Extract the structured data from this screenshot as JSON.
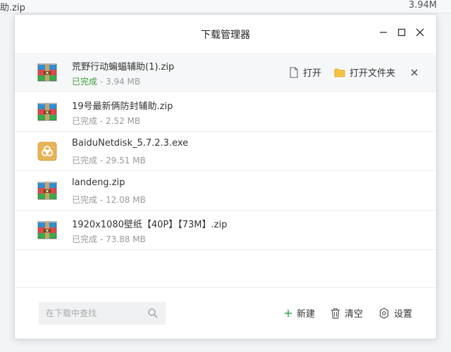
{
  "background": {
    "left_text": "助.zip",
    "right_text": "3.94M"
  },
  "dialog": {
    "title": "下载管理器"
  },
  "files": [
    {
      "name": "荒野行动蝙蝠辅助(1).zip",
      "status": "已完成",
      "size": "3.94 MB",
      "icon": "zip-archive-icon"
    },
    {
      "name": "19号最新俩防封辅助.zip",
      "status": "已完成",
      "size": "2.52 MB",
      "icon": "zip-archive-icon"
    },
    {
      "name": "BaiduNetdisk_5.7.2.3.exe",
      "status": "已完成",
      "size": "29.51 MB",
      "icon": "baidu-netdisk-exe-icon"
    },
    {
      "name": "landeng.zip",
      "status": "已完成",
      "size": "12.08 MB",
      "icon": "zip-archive-icon"
    },
    {
      "name": "1920x1080壁纸【40P】【73M】.zip",
      "status": "已完成",
      "size": "73.88 MB",
      "icon": "zip-archive-icon"
    }
  ],
  "row_actions": {
    "open_label": "打开",
    "open_folder_label": "打开文件夹"
  },
  "status_separator": "-",
  "footer": {
    "search_placeholder": "在下载中查找",
    "new_label": "新建",
    "clear_label": "清空",
    "settings_label": "设置"
  },
  "colors": {
    "done_green": "#3a9e3a",
    "accent_green": "#2fa54c",
    "folder_yellow": "#f5c242"
  }
}
